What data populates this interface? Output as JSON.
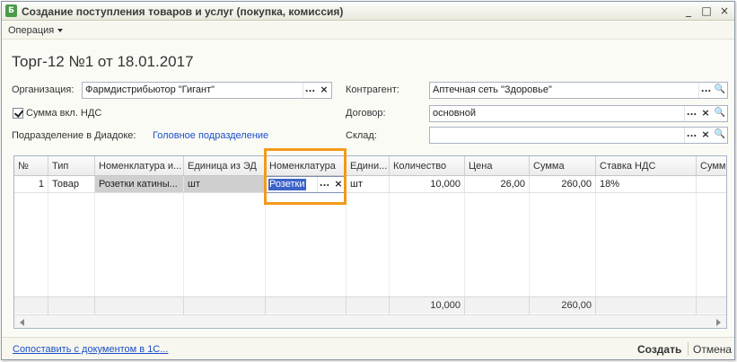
{
  "window": {
    "title": "Создание поступления товаров и услуг (покупка, комиссия)",
    "icon_glyph": "Б",
    "controls": {
      "minimize": "_",
      "maximize": "□",
      "close": "×"
    }
  },
  "menu": {
    "operation": "Операция"
  },
  "document": {
    "title": "Торг-12 №1 от 18.01.2017"
  },
  "form": {
    "organization_label": "Организация:",
    "organization_value": "Фармдистрибьютор \"Гигант\"",
    "counterparty_label": "Контрагент:",
    "counterparty_value": "Аптечная сеть \"Здоровье\"",
    "vat_checkbox_label": "Сумма вкл. НДС",
    "contract_label": "Договор:",
    "contract_value": "основной",
    "department_label": "Подразделение в Диадоке:",
    "department_value": "Головное подразделение",
    "warehouse_label": "Склад:",
    "warehouse_value": "",
    "button_select": "...",
    "button_clear": "×",
    "button_search": "🔍"
  },
  "table": {
    "columns": [
      "№",
      "Тип",
      "Номенклатура и...",
      "Единица из ЭД",
      "Номенклатура",
      "Едини...",
      "Количество",
      "Цена",
      "Сумма",
      "Ставка НДС",
      "Сумма"
    ],
    "row": {
      "n": "1",
      "type": "Товар",
      "nomenclature_ed": "Розетки катины...",
      "unit_ed": "шт",
      "nomenclature_edit": "Розетки",
      "unit": "шт",
      "quantity": "10,000",
      "price": "26,00",
      "sum": "260,00",
      "vat_rate": "18%"
    },
    "footer": {
      "quantity_total": "10,000",
      "sum_total": "260,00"
    }
  },
  "bottom": {
    "link": "Сопоставить с документом в 1С...",
    "create": "Создать",
    "cancel": "Отмена"
  },
  "colors": {
    "accent_highlight": "#f29a1a",
    "link": "#1b4fc9",
    "selection": "#3b63c9"
  }
}
